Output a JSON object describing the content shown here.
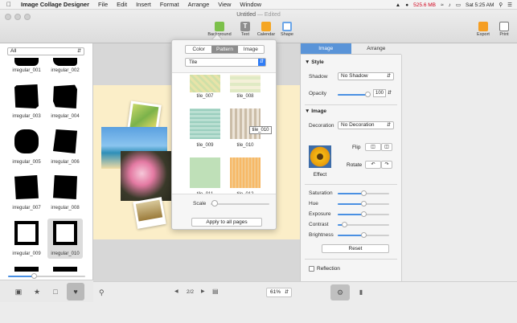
{
  "menubar": {
    "app_name": "Image Collage Designer",
    "items": [
      "File",
      "Edit",
      "Insert",
      "Format",
      "Arrange",
      "View",
      "Window"
    ],
    "memory": "525.6 MB",
    "clock": "Sat 5:25 AM"
  },
  "window": {
    "title": "Untitled",
    "edited": "— Edited"
  },
  "toolbar": {
    "background": "Background",
    "text": "Text",
    "calendar": "Calendar",
    "shape": "Shape",
    "export": "Export",
    "print": "Print"
  },
  "left_sidebar": {
    "filter_value": "All",
    "masks": [
      "irregular_001",
      "irregular_002",
      "irregular_003",
      "irregular_004",
      "irregular_005",
      "irregular_006",
      "irregular_007",
      "irregular_008",
      "irregular_009",
      "irregular_010"
    ],
    "selected_mask": "irregular_010",
    "size_slider": 0.33
  },
  "popover": {
    "tabs": [
      "Color",
      "Pattern",
      "Image"
    ],
    "active_tab": "Pattern",
    "mode_value": "Tile",
    "tiles": [
      "tile_007",
      "tile_008",
      "tile_009",
      "tile_010",
      "tile_011",
      "tile_012"
    ],
    "scale_label": "Scale",
    "scale_value": 0.0,
    "apply_label": "Apply to all pages",
    "tooltip": "tile_010"
  },
  "canvas": {
    "page_indicator": "2/2",
    "zoom": "61%"
  },
  "inspector": {
    "tabs": [
      "Image",
      "Arrange"
    ],
    "active_tab": "Image",
    "style_header": "Style",
    "shadow_label": "Shadow",
    "shadow_value": "No Shadow",
    "opacity_label": "Opacity",
    "opacity_value": "100",
    "image_header": "Image",
    "decoration_label": "Decoration",
    "decoration_value": "No Decoration",
    "flip_label": "Flip",
    "rotate_label": "Rotate",
    "effect_label": "Effect",
    "adjustments": [
      {
        "label": "Saturation",
        "level": 0.5
      },
      {
        "label": "Hue",
        "level": 0.5
      },
      {
        "label": "Exposure",
        "level": 0.5
      },
      {
        "label": "Contrast",
        "level": 0.12
      },
      {
        "label": "Brightness",
        "level": 0.5
      }
    ],
    "reset_label": "Reset",
    "reflection_label": "Reflection"
  },
  "colors": {
    "accent": "#4a90e2",
    "tab_active": "#5a94d8",
    "canvas_page": "#fbeec8"
  }
}
